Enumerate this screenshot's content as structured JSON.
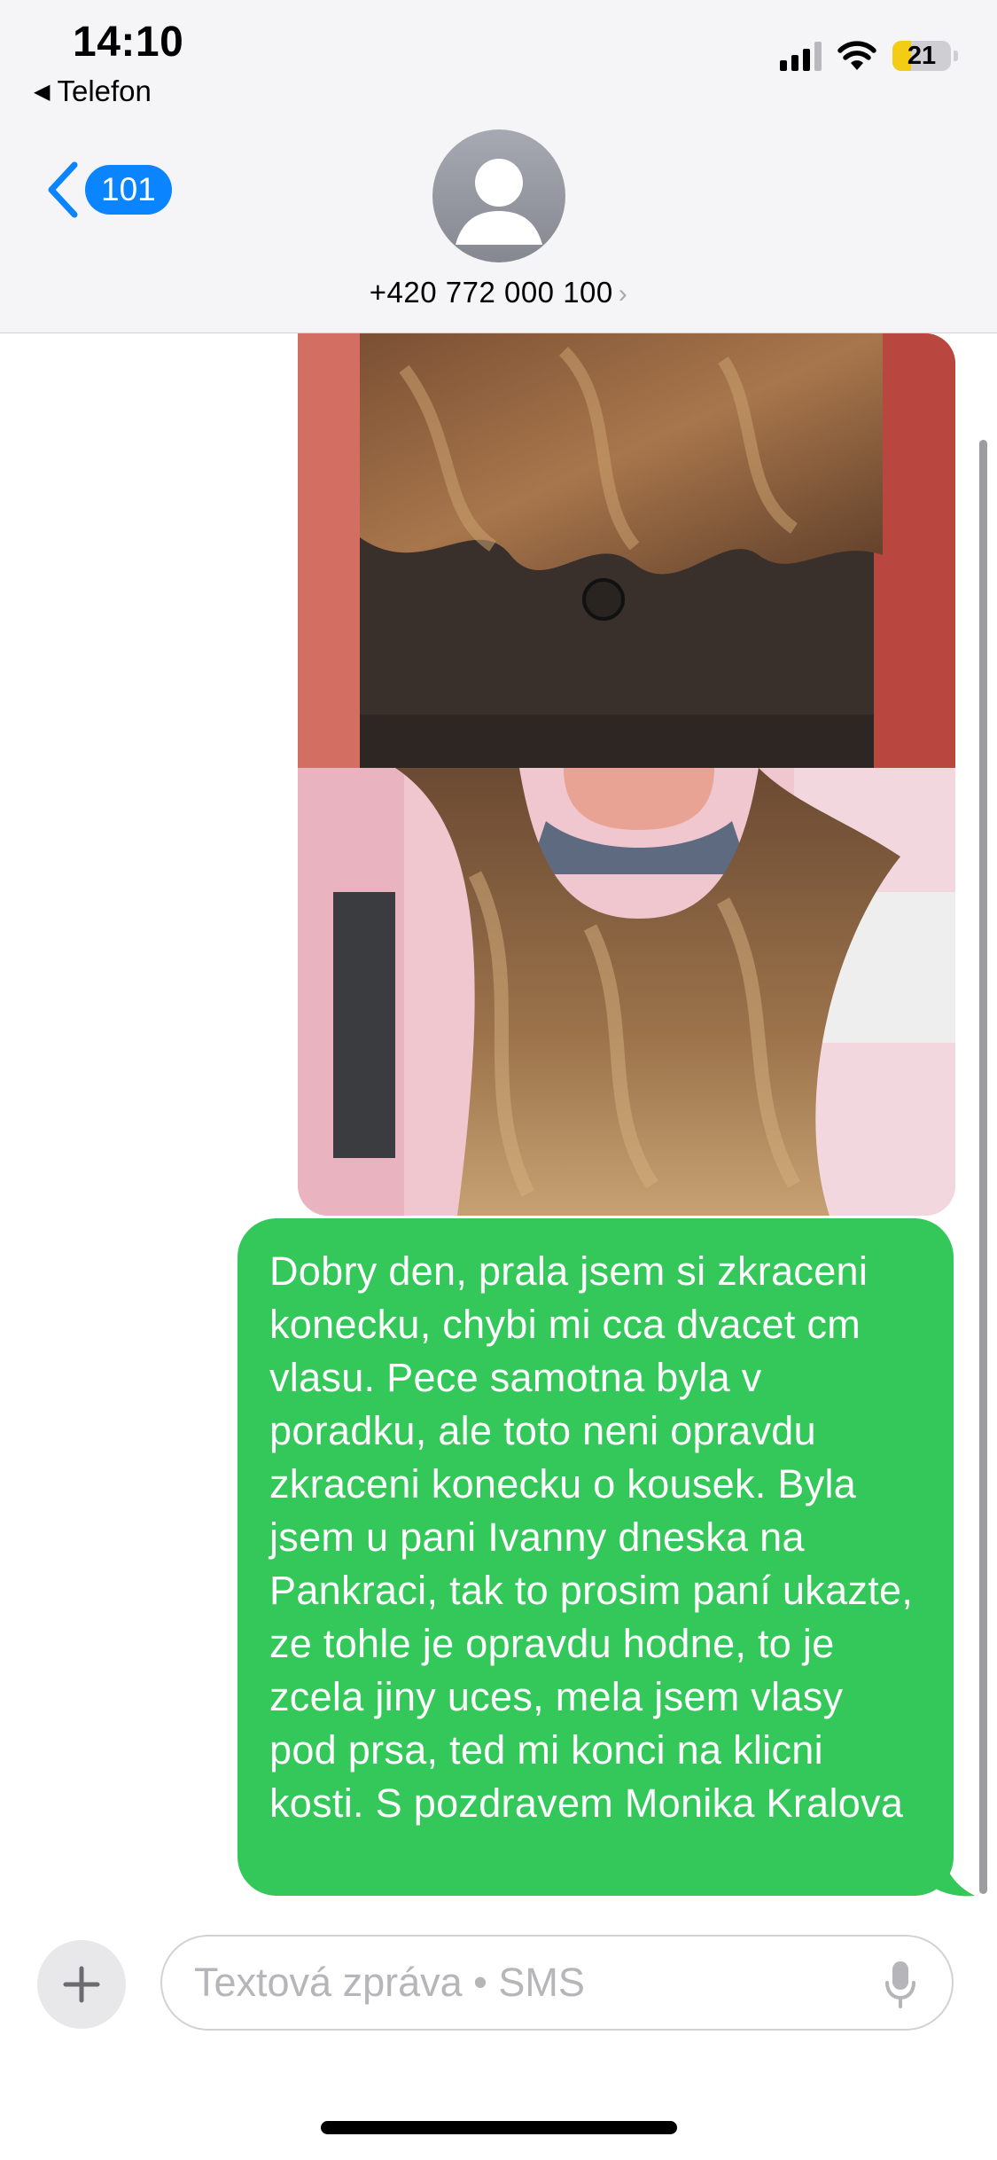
{
  "status_bar": {
    "time": "14:10",
    "back_app": "Telefon",
    "battery_percent": "21",
    "battery_level": 0.21,
    "signal_bars": 3,
    "icons": [
      "cellular-signal-icon",
      "wifi-icon",
      "battery-icon"
    ]
  },
  "nav": {
    "back_badge": "101",
    "contact_name": "+420 772 000 100",
    "chevron": "›"
  },
  "conversation": {
    "photos": [
      {
        "name": "sent-photo-hair-back",
        "description_color": "#6b4a33"
      },
      {
        "name": "sent-photo-hair-front",
        "description_color": "#8a6445"
      }
    ],
    "messages": [
      {
        "direction": "sent",
        "text": "Dobry den, prala jsem si zkraceni konecku, chybi mi cca dvacet cm vlasu. Pece samotna byla v poradku, ale toto neni opravdu zkraceni konecku o kousek. Byla jsem u pani Ivanny dneska na Pankraci, tak to prosim paní ukazte, ze tohle je opravdu hodne, to je zcela jiny uces, mela jsem vlasy pod prsa, ted mi konci na klicni kosti. S pozdravem Monika Kralova"
      }
    ]
  },
  "compose": {
    "placeholder": "Textová zpráva • SMS",
    "value": ""
  },
  "colors": {
    "accent": "#0a84ff",
    "sms_bubble": "#34c759",
    "header_bg": "#f5f5f7",
    "battery_fill": "#f4cc14"
  }
}
